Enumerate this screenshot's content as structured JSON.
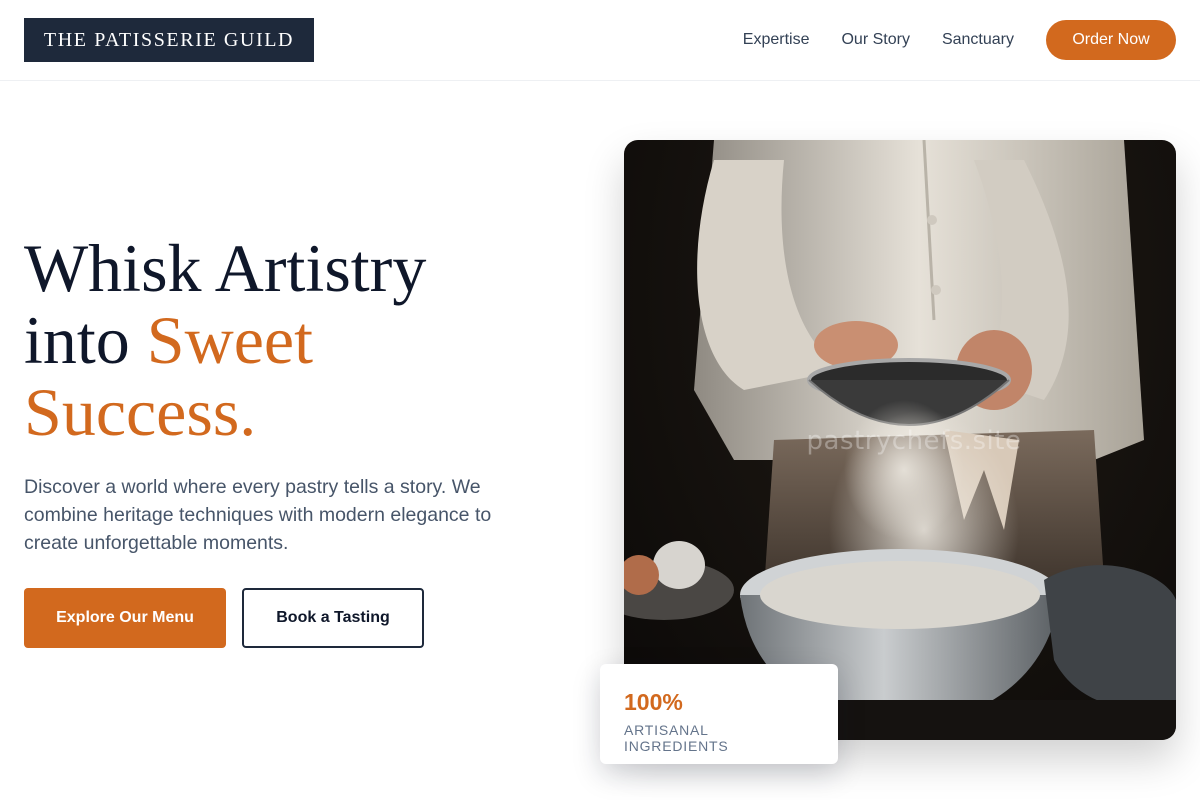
{
  "brand": {
    "name": "THE PATISSERIE GUILD"
  },
  "nav": {
    "links": [
      {
        "label": "Expertise"
      },
      {
        "label": "Our Story"
      },
      {
        "label": "Sanctuary"
      }
    ],
    "cta_label": "Order Now"
  },
  "hero": {
    "headline_line1": "Whisk Artistry",
    "headline_line2_plain": "into ",
    "headline_line2_accent": "Sweet",
    "headline_line3_accent": "Success.",
    "subcopy": "Discover a world where every pastry tells a story. We combine heritage techniques with modern elegance to create unforgettable moments.",
    "primary_button": "Explore Our Menu",
    "secondary_button": "Book a Tasting",
    "image_watermark": "pastrychefs.site"
  },
  "stat": {
    "value": "100%",
    "label": "ARTISANAL INGREDIENTS"
  },
  "colors": {
    "accent": "#d2691e",
    "navy": "#1e293b",
    "text_muted": "#475569"
  }
}
